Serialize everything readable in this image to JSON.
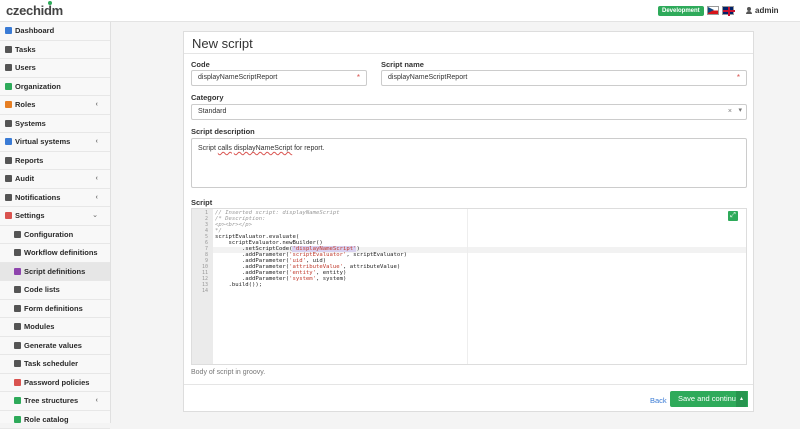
{
  "header": {
    "logo_main": "czech",
    "logo_accent": "idm",
    "environment": "Development",
    "username": "admin"
  },
  "sidebar": {
    "items": [
      {
        "label": "Dashboard",
        "icon": "dashboard-icon",
        "color": "#3a7bd5",
        "chevron": ""
      },
      {
        "label": "Tasks",
        "icon": "list-icon",
        "color": "#555555",
        "chevron": ""
      },
      {
        "label": "Users",
        "icon": "users-icon",
        "color": "#555555",
        "chevron": ""
      },
      {
        "label": "Organization",
        "icon": "folder-icon",
        "color": "#2eaa5a",
        "chevron": ""
      },
      {
        "label": "Roles",
        "icon": "key-icon",
        "color": "#e67e22",
        "chevron": "‹"
      },
      {
        "label": "Systems",
        "icon": "link-icon",
        "color": "#555555",
        "chevron": ""
      },
      {
        "label": "Virtual systems",
        "icon": "link-icon",
        "color": "#3a7bd5",
        "chevron": "‹"
      },
      {
        "label": "Reports",
        "icon": "chart-icon",
        "color": "#555555",
        "chevron": ""
      },
      {
        "label": "Audit",
        "icon": "history-icon",
        "color": "#555555",
        "chevron": "‹"
      },
      {
        "label": "Notifications",
        "icon": "envelope-icon",
        "color": "#555555",
        "chevron": "‹"
      },
      {
        "label": "Settings",
        "icon": "cog-icon",
        "color": "#d9534f",
        "chevron": "⌄"
      }
    ],
    "subitems": [
      {
        "label": "Configuration",
        "icon": "cog-icon",
        "color": "#555555"
      },
      {
        "label": "Workflow definitions",
        "icon": "sitemap-icon",
        "color": "#555555"
      },
      {
        "label": "Script definitions",
        "icon": "script-icon",
        "color": "#8e44ad"
      },
      {
        "label": "Code lists",
        "icon": "list-icon",
        "color": "#555555"
      },
      {
        "label": "Form definitions",
        "icon": "form-icon",
        "color": "#555555"
      },
      {
        "label": "Modules",
        "icon": "cube-icon",
        "color": "#555555"
      },
      {
        "label": "Generate values",
        "icon": "shuffle-icon",
        "color": "#555555"
      },
      {
        "label": "Task scheduler",
        "icon": "calendar-icon",
        "color": "#555555"
      },
      {
        "label": "Password policies",
        "icon": "lock-icon",
        "color": "#d9534f"
      },
      {
        "label": "Tree structures",
        "icon": "folder-icon",
        "color": "#2eaa5a",
        "chevron": "‹"
      },
      {
        "label": "Role catalog",
        "icon": "folder-icon",
        "color": "#2eaa5a"
      }
    ]
  },
  "form": {
    "title": "New script",
    "code_label": "Code",
    "code_value": "displayNameScriptReport",
    "name_label": "Script name",
    "name_value": "displayNameScriptReport",
    "required_mark": "*",
    "category_label": "Category",
    "category_value": "Standard",
    "clear_mark": "×",
    "description_label": "Script description",
    "description_pre": "Script ",
    "description_spell": "calls",
    "description_mid": " ",
    "description_spell2": "displayNameScript",
    "description_post": " for report.",
    "script_label": "Script",
    "script_help": "Body of script in groovy.",
    "back_label": "Back",
    "save_label": "Save and continue"
  },
  "code": {
    "line_numbers": [
      "1",
      "2",
      "3",
      "4",
      "5",
      "6",
      "7",
      "8",
      "9",
      "10",
      "11",
      "12",
      "13",
      "14"
    ],
    "l1": "// Inserted script: displayNameScript",
    "l2": "/* Description:",
    "l3": "<p><br></p>",
    "l4": "*/",
    "l5": "scriptEvaluator.evaluate(",
    "l6": "    scriptEvaluator.newBuilder()",
    "l7a": "        .setScriptCode(",
    "l7b": "'displayNameScript'",
    "l7c": ")",
    "l8a": "        .addParameter(",
    "l8b": "'scriptEvaluator'",
    "l8c": ", scriptEvaluator)",
    "l9a": "        .addParameter(",
    "l9b": "'uid'",
    "l9c": ", uid)",
    "l10a": "        .addParameter(",
    "l10b": "'attributeValue'",
    "l10c": ", attributeValue)",
    "l11a": "        .addParameter(",
    "l11b": "'entity'",
    "l11c": ", entity)",
    "l12a": "        .addParameter(",
    "l12b": "'system'",
    "l12c": ", system)",
    "l13": "    .build());",
    "l14": ""
  }
}
